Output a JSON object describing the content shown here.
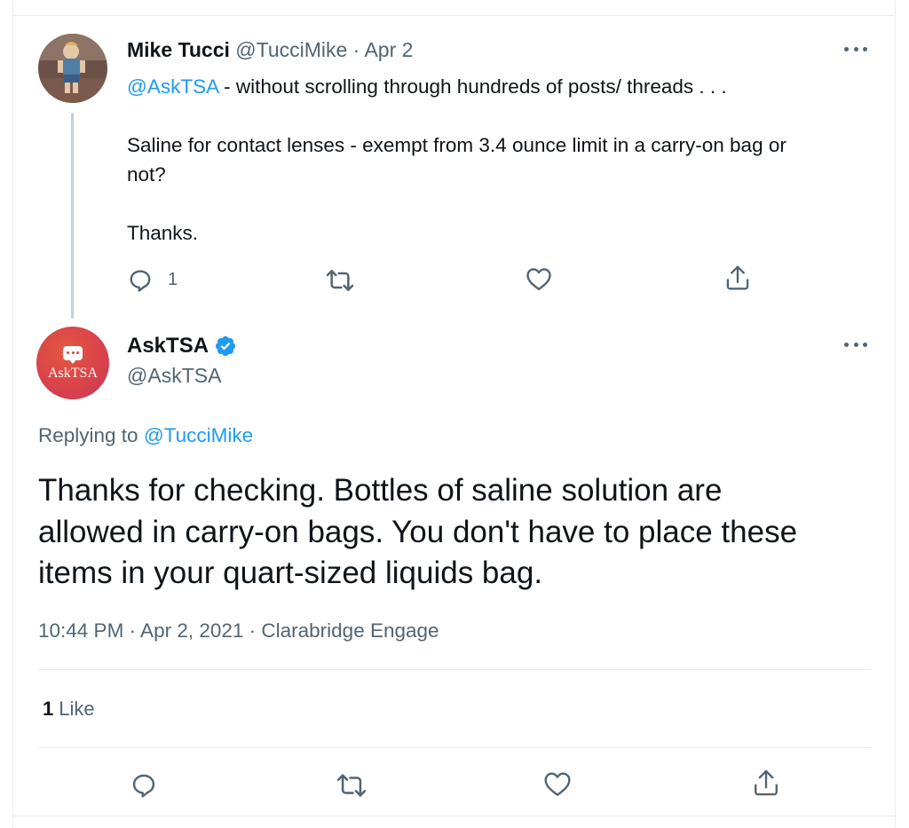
{
  "parent_tweet": {
    "author_name": "Mike Tucci",
    "handle": "@TucciMike",
    "separator": " · ",
    "date": "Apr 2",
    "mention": "@AskTSA",
    "line1_rest": " - without scrolling through hundreds of posts/ threads . . .",
    "line2": "Saline for contact lenses - exempt from 3.4 ounce limit in a carry-on bag or",
    "line3": "not?",
    "line4": "Thanks.",
    "reply_count": "1"
  },
  "reply_tweet": {
    "author_name": "AskTSA",
    "handle": "@AskTSA",
    "avatar_label": "AskTSA",
    "replying_prefix": "Replying to ",
    "replying_to": "@TucciMike",
    "text_lines": [
      "Thanks for checking. Bottles of saline solution are",
      "allowed in carry-on bags. You don't have to place these",
      "items in your quart-sized liquids bag."
    ],
    "timestamp": "10:44 PM · Apr 2, 2021 · Clarabridge Engage",
    "like_count": "1",
    "like_label": "Like"
  },
  "icons": {
    "reply": "reply-icon",
    "retweet": "retweet-icon",
    "like": "heart-icon",
    "share": "share-icon",
    "more": "more-icon",
    "verified": "verified-badge-icon"
  },
  "colors": {
    "accent": "#1d9bf0",
    "secondary_text": "#536471",
    "avatar_tsa": "#d9434a"
  }
}
